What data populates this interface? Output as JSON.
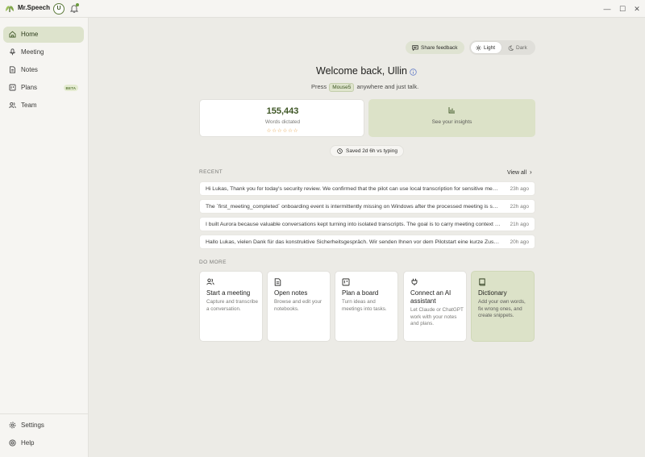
{
  "app": {
    "name": "Mr.Speech",
    "user_initial": "U"
  },
  "window_controls": {
    "minimize": "—",
    "maximize": "☐",
    "close": "✕"
  },
  "sidebar": {
    "items": [
      {
        "label": "Home",
        "icon": "home-icon"
      },
      {
        "label": "Meeting",
        "icon": "mic-icon"
      },
      {
        "label": "Notes",
        "icon": "notes-icon"
      },
      {
        "label": "Plans",
        "icon": "board-icon",
        "badge": "BETA"
      },
      {
        "label": "Team",
        "icon": "team-icon"
      }
    ],
    "footer": [
      {
        "label": "Settings",
        "icon": "gear-icon"
      },
      {
        "label": "Help",
        "icon": "help-icon"
      }
    ]
  },
  "header": {
    "feedback": "Share feedback",
    "theme": {
      "light": "Light",
      "dark": "Dark",
      "selected": "Light"
    }
  },
  "welcome": {
    "title": "Welcome back, Ullin",
    "shortcut_prefix": "Press",
    "shortcut_key": "Mouse5",
    "shortcut_suffix": "anywhere and just talk."
  },
  "stats": {
    "words_value": "155,443",
    "words_label": "Words dictated",
    "stars": "☆☆☆☆☆☆",
    "insights_label": "See your insights",
    "saved": "Saved 2d 6h vs typing"
  },
  "recent": {
    "title": "RECENT",
    "view_all": "View all",
    "items": [
      {
        "text": "Hi Lukas, Thank you for today's security review. We confirmed that the pilot can use local transcription for sensitive meetings",
        "time": "23h ago"
      },
      {
        "text": "The `first_meeting_completed` onboarding event is intermittently missing on Windows after the processed meeting is saved",
        "time": "22h ago"
      },
      {
        "text": "I built Aurora because valuable conversations kept turning into isolated transcripts. The goal is to carry meeting context forward",
        "time": "21h ago"
      },
      {
        "text": "Hallo Lukas, vielen Dank für das konstruktive Sicherheitsgespräch. Wir senden Ihnen vor dem Pilotstart eine kurze Zusammenfassung",
        "time": "20h ago"
      }
    ]
  },
  "do_more": {
    "title": "DO MORE",
    "cards": [
      {
        "title": "Start a meeting",
        "desc": "Capture and transcribe a conversation.",
        "icon": "team-icon"
      },
      {
        "title": "Open notes",
        "desc": "Browse and edit your notebooks.",
        "icon": "notes-icon"
      },
      {
        "title": "Plan a board",
        "desc": "Turn ideas and meetings into tasks.",
        "icon": "board-icon"
      },
      {
        "title": "Connect an AI assistant",
        "desc": "Let Claude or ChatGPT work with your notes and plans.",
        "icon": "plug-icon"
      },
      {
        "title": "Dictionary",
        "desc": "Add your own words, fix wrong ones, and create snippets.",
        "icon": "book-icon"
      }
    ]
  },
  "colors": {
    "accent": "#5c7a3a",
    "accent_soft": "#dce2c8",
    "background": "#ecebe6",
    "surface": "#f6f5f2",
    "star": "#e39a3b"
  }
}
